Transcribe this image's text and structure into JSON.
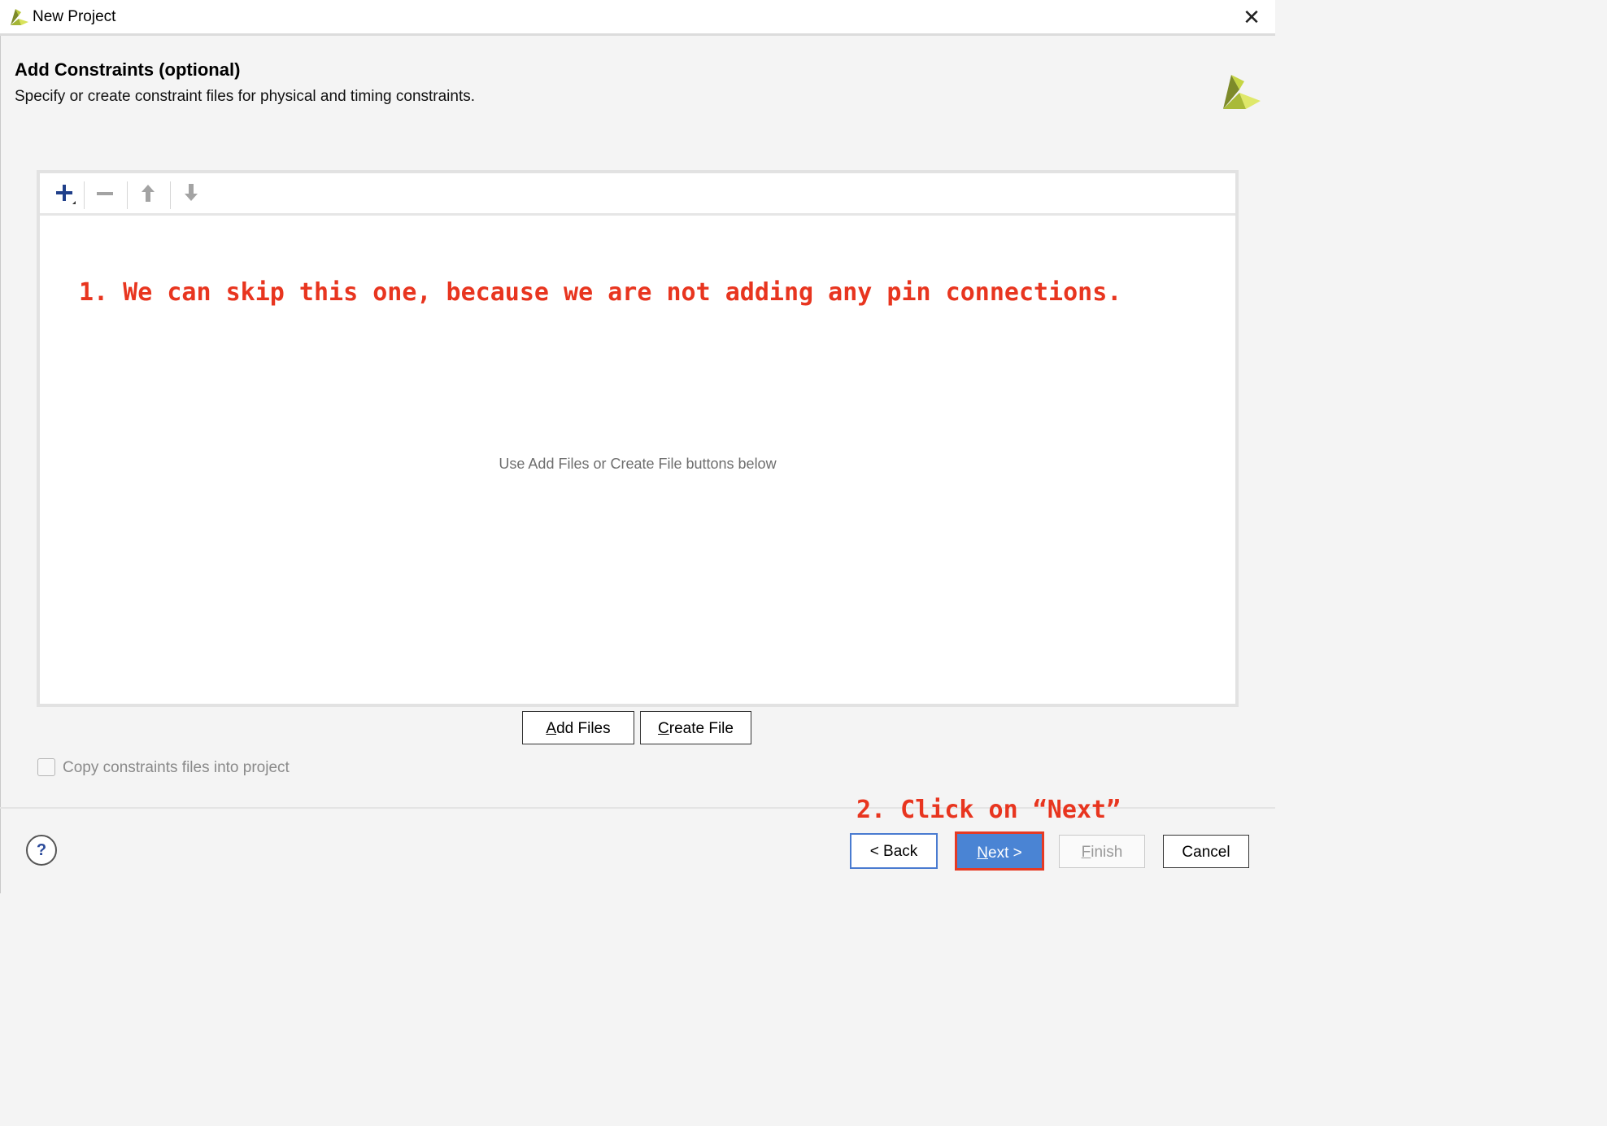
{
  "window": {
    "title": "New Project",
    "close_label": "✕"
  },
  "header": {
    "heading": "Add Constraints (optional)",
    "subtitle": "Specify or create constraint files for physical and timing constraints."
  },
  "toolbar": {
    "add_icon": "plus-icon",
    "remove_icon": "minus-icon",
    "move_up_icon": "arrow-up-icon",
    "move_down_icon": "arrow-down-icon"
  },
  "list": {
    "empty_hint": "Use Add Files or Create File buttons below"
  },
  "annotations": {
    "step1": "1. We can skip this one, because we are not adding any pin connections.",
    "step2": "2. Click on “Next”"
  },
  "actions": {
    "add_files_pre": "",
    "add_files_mnemonic": "A",
    "add_files_post": "dd Files",
    "create_file_pre": "",
    "create_file_mnemonic": "C",
    "create_file_post": "reate File"
  },
  "options": {
    "copy_label": "Copy constraints files into project",
    "copy_checked": false
  },
  "footer": {
    "help_label": "?",
    "back_label": "< Back",
    "next_mnemonic": "N",
    "next_rest": "ext >",
    "finish_mnemonic": "F",
    "finish_rest": "inish",
    "cancel_label": "Cancel"
  },
  "colors": {
    "annotation": "#e8351f",
    "primary_button": "#4a84d4",
    "highlight_border": "#e53a24",
    "focus_border": "#4a7bd0"
  }
}
